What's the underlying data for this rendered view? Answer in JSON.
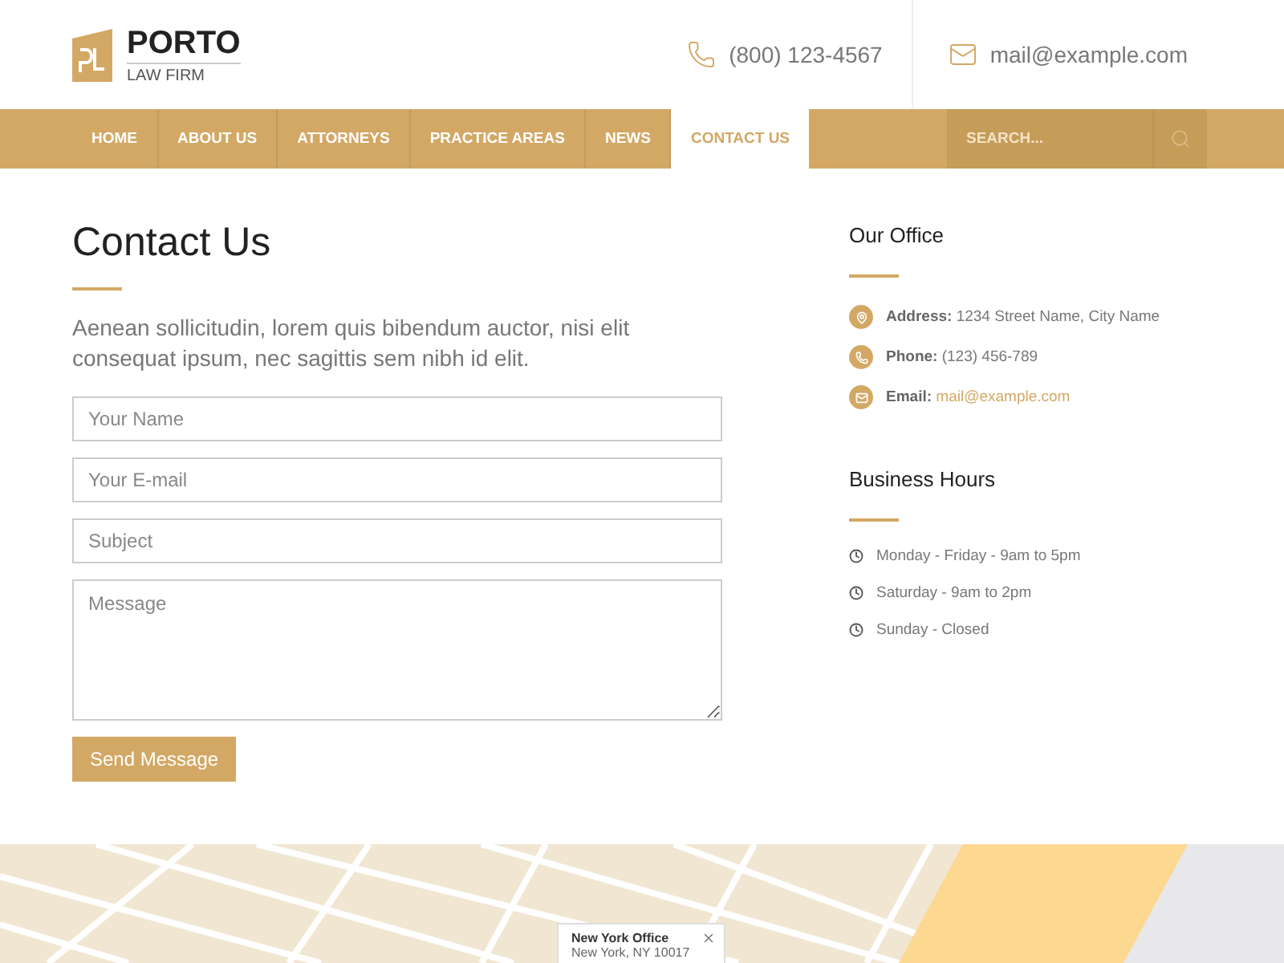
{
  "logo": {
    "name": "PORTO",
    "tagline": "LAW FIRM"
  },
  "header_contacts": [
    {
      "kind": "phone",
      "text": "(800) 123-4567"
    },
    {
      "kind": "email",
      "text": "mail@example.com"
    }
  ],
  "nav": {
    "items": [
      {
        "label": "HOME",
        "selected": false
      },
      {
        "label": "ABOUT US",
        "selected": false
      },
      {
        "label": "ATTORNEYS",
        "selected": false
      },
      {
        "label": "PRACTICE AREAS",
        "selected": false
      },
      {
        "label": "NEWS",
        "selected": false
      },
      {
        "label": "CONTACT US",
        "selected": true
      }
    ],
    "search": {
      "placeholder": "SEARCH..."
    }
  },
  "contact": {
    "title": "Contact Us",
    "intro": "Aenean sollicitudin, lorem quis bibendum auctor, nisi elit consequat ipsum, nec sagittis sem nibh id elit.",
    "fields": [
      {
        "kind": "input",
        "placeholder": "Your Name"
      },
      {
        "kind": "input",
        "placeholder": "Your E-mail"
      },
      {
        "kind": "input",
        "placeholder": "Subject"
      },
      {
        "kind": "textarea",
        "placeholder": "Message"
      }
    ],
    "button": "Send Message"
  },
  "office": {
    "title": "Our Office",
    "items": [
      {
        "kind": "address",
        "label": "Address:",
        "value": "1234 Street Name, City Name"
      },
      {
        "kind": "phone",
        "label": "Phone:",
        "value": "(123) 456-789"
      },
      {
        "kind": "email",
        "label": "Email:",
        "value": "mail@example.com"
      }
    ]
  },
  "hours": {
    "title": "Business Hours",
    "items": [
      "Monday - Friday - 9am to 5pm",
      "Saturday - 9am to 2pm",
      "Sunday - Closed"
    ]
  },
  "map": {
    "popup": {
      "title": "New York Office",
      "subtitle": "New York, NY 10017"
    }
  }
}
